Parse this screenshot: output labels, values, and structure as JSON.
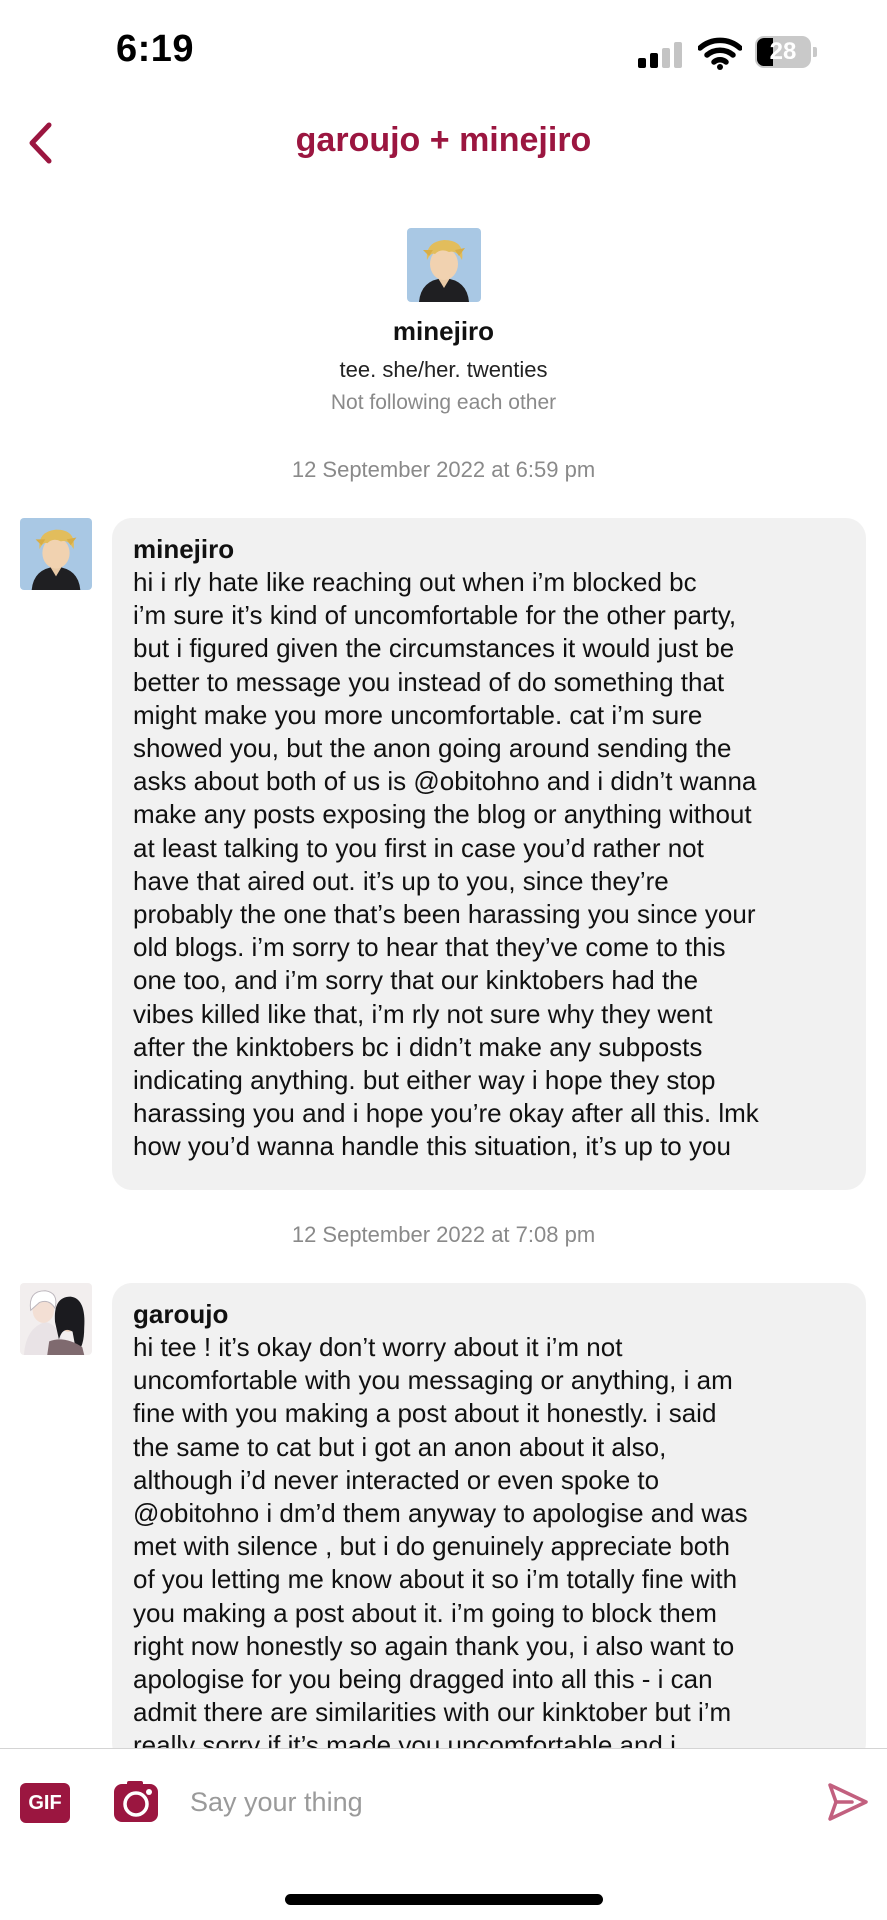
{
  "status_bar": {
    "time": "6:19",
    "battery_level": "28",
    "signal_bars_active": 2,
    "signal_bars_total": 4
  },
  "header": {
    "title": "garoujo + minejiro",
    "back_icon": "chevron-left-icon"
  },
  "profile": {
    "name": "minejiro",
    "bio": "tee. she/her. twenties",
    "follow_status": "Not following each other"
  },
  "conversation": [
    {
      "timestamp": "12 September 2022 at 6:59 pm",
      "sender": "minejiro",
      "text": "hi i rly hate like reaching out when i’m blocked bc\ni’m sure it’s kind of uncomfortable for the other party,\nbut i figured given the circumstances it would just be\nbetter to message you instead of do something that\nmight make you more uncomfortable. cat i’m sure\nshowed you, but the anon going around sending the\nasks about both of us is @obitohno and i didn’t wanna\nmake any posts exposing the blog or anything without\nat least talking to you first in case you’d rather not\nhave that aired out. it’s up to you, since they’re\nprobably the one that’s been harassing you since your\nold blogs. i’m sorry to hear that they’ve come to this\none too, and i’m sorry that our kinktobers had the\nvibes killed like that, i’m rly not sure why they went\nafter the kinktobers bc i didn’t make any subposts\nindicating anything. but either way i hope they stop\nharassing you and i hope you’re okay after all this. lmk\nhow you’d wanna handle this situation, it’s up to you"
    },
    {
      "timestamp": "12 September 2022 at 7:08 pm",
      "sender": "garoujo",
      "text": "hi tee ! it’s okay don’t worry about it i’m not\nuncomfortable with you messaging or anything, i am\nfine with you making a post about it honestly. i said\nthe same to cat but i got an anon about it also,\nalthough i’d never interacted or even spoke to\n@obitohno i dm’d them anyway to apologise and was\nmet with silence , but i do genuinely appreciate both\nof you letting me know about it so i’m totally fine with\nyou making a post about it. i’m going to block them\nright now honestly so again thank you, i also want to\napologise for you being dragged into all this - i can\nadmit there are similarities with our kinktober but i’m\nreally sorry if it’s made you uncomfortable and i"
    }
  ],
  "composer": {
    "gif_label": "GIF",
    "placeholder": "Say your thing"
  },
  "colors": {
    "accent": "#9b1640",
    "bubble_bg": "#f1f1f1",
    "muted_text": "#8a8a8a",
    "send_icon": "#c2607f"
  }
}
